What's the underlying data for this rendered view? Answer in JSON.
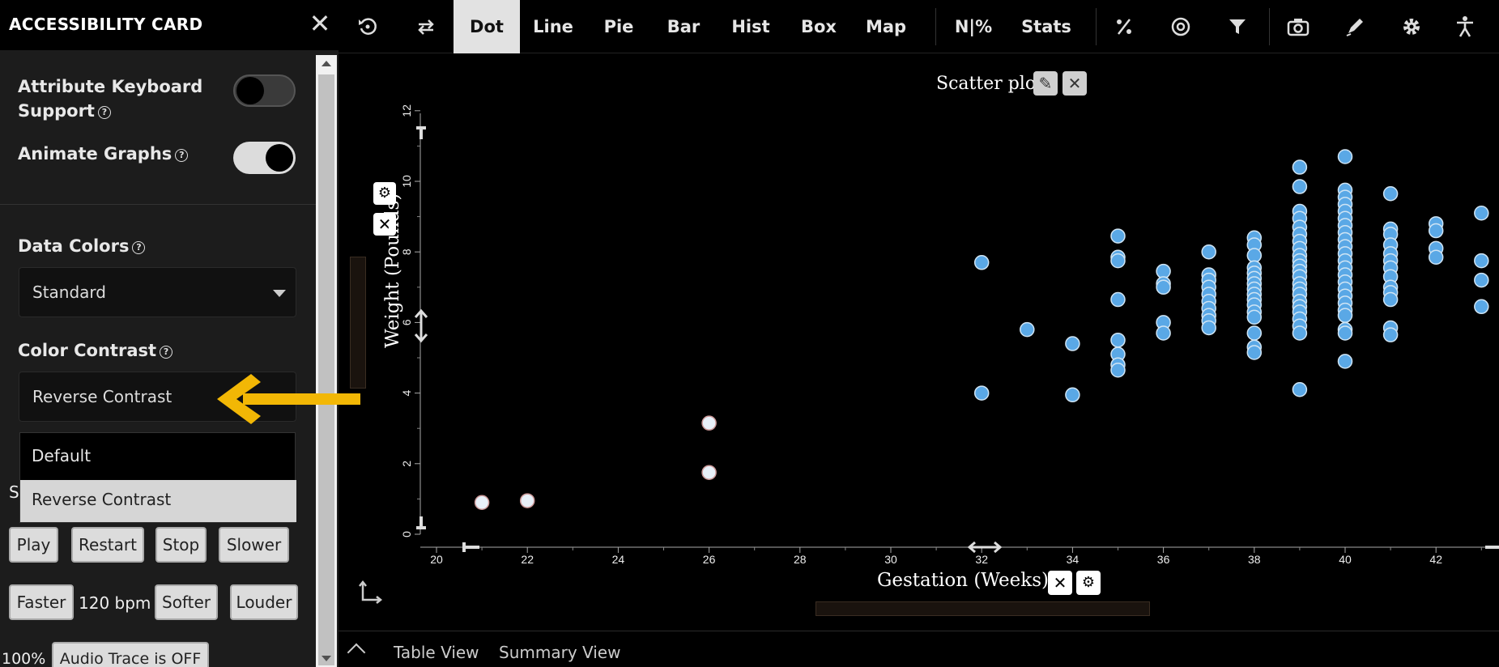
{
  "panel": {
    "title": "ACCESSIBILITY CARD",
    "close_icon": "close-icon",
    "keyboard_support": {
      "label_line1": "Attribute Keyboard",
      "label_line2": "Support",
      "enabled": false
    },
    "animate_graphs": {
      "label": "Animate Graphs",
      "enabled": true
    },
    "data_colors": {
      "label": "Data Colors",
      "value": "Standard"
    },
    "color_contrast": {
      "label": "Color Contrast",
      "value": "Reverse Contrast",
      "options": [
        "Default",
        "Reverse Contrast"
      ]
    },
    "help_glyph": "?",
    "sonify_partial_label": "S",
    "buttons": {
      "play": "Play",
      "restart": "Restart",
      "stop": "Stop",
      "slower": "Slower",
      "faster": "Faster",
      "softer": "Softer",
      "louder": "Louder",
      "audio_trace": "Audio Trace is OFF"
    },
    "tempo": "120 bpm",
    "volume": "100%"
  },
  "toolbar": {
    "items": [
      "Dot",
      "Line",
      "Pie",
      "Bar",
      "Hist",
      "Box",
      "Map",
      "N|%",
      "Stats"
    ],
    "active": "Dot",
    "icons": [
      "reset-icon",
      "swap-icon",
      "percent-icon",
      "target-icon",
      "filter-icon",
      "camera-icon",
      "pen-icon",
      "gear-icon",
      "accessibility-icon"
    ]
  },
  "graph": {
    "title": "Scatter plot"
  },
  "bottom_bar": {
    "table_view": "Table View",
    "summary_view": "Summary View"
  },
  "colors": {
    "point_fill": "#5aa8e6",
    "point_stroke": "#cfe4f4",
    "point_light": "#e8f0f8",
    "accent_arrow": "#f2b705"
  },
  "chart_data": {
    "type": "scatter",
    "title": "Scatter plot",
    "xlabel": "Gestation (Weeks)",
    "ylabel": "Weight (Pounds)",
    "xlim": [
      19.8,
      43
    ],
    "ylim": [
      0,
      12
    ],
    "xticks": [
      20,
      22,
      24,
      26,
      28,
      30,
      32,
      34,
      36,
      38,
      40,
      42
    ],
    "yticks": [
      0,
      2,
      4,
      6,
      8,
      10,
      12
    ],
    "grid": false,
    "points": [
      [
        21,
        0.9
      ],
      [
        22,
        0.95
      ],
      [
        26,
        3.15
      ],
      [
        26,
        1.75
      ],
      [
        32,
        7.7
      ],
      [
        32,
        4.0
      ],
      [
        33,
        5.8
      ],
      [
        34,
        5.4
      ],
      [
        34,
        3.95
      ],
      [
        35,
        8.45
      ],
      [
        35,
        7.85
      ],
      [
        35,
        7.75
      ],
      [
        35,
        6.65
      ],
      [
        35,
        5.5
      ],
      [
        35,
        5.1
      ],
      [
        35,
        4.8
      ],
      [
        35,
        4.65
      ],
      [
        36,
        7.45
      ],
      [
        36,
        7.1
      ],
      [
        36,
        7.0
      ],
      [
        36,
        6.0
      ],
      [
        36,
        5.7
      ],
      [
        37,
        8.0
      ],
      [
        37,
        7.35
      ],
      [
        37,
        7.2
      ],
      [
        37,
        7.0
      ],
      [
        37,
        6.8
      ],
      [
        37,
        6.6
      ],
      [
        37,
        6.4
      ],
      [
        37,
        6.2
      ],
      [
        37,
        6.05
      ],
      [
        37,
        5.85
      ],
      [
        38,
        8.4
      ],
      [
        38,
        8.2
      ],
      [
        38,
        7.9
      ],
      [
        38,
        7.55
      ],
      [
        38,
        7.4
      ],
      [
        38,
        7.25
      ],
      [
        38,
        7.1
      ],
      [
        38,
        6.95
      ],
      [
        38,
        6.8
      ],
      [
        38,
        6.65
      ],
      [
        38,
        6.5
      ],
      [
        38,
        6.3
      ],
      [
        38,
        6.15
      ],
      [
        38,
        5.7
      ],
      [
        38,
        5.3
      ],
      [
        38,
        5.15
      ],
      [
        39,
        10.4
      ],
      [
        39,
        9.85
      ],
      [
        39,
        9.15
      ],
      [
        39,
        8.95
      ],
      [
        39,
        8.7
      ],
      [
        39,
        8.5
      ],
      [
        39,
        8.3
      ],
      [
        39,
        8.1
      ],
      [
        39,
        7.9
      ],
      [
        39,
        7.75
      ],
      [
        39,
        7.6
      ],
      [
        39,
        7.45
      ],
      [
        39,
        7.3
      ],
      [
        39,
        7.1
      ],
      [
        39,
        6.95
      ],
      [
        39,
        6.8
      ],
      [
        39,
        6.6
      ],
      [
        39,
        6.45
      ],
      [
        39,
        6.3
      ],
      [
        39,
        6.1
      ],
      [
        39,
        5.9
      ],
      [
        39,
        5.7
      ],
      [
        39,
        4.1
      ],
      [
        40,
        10.7
      ],
      [
        40,
        9.75
      ],
      [
        40,
        9.55
      ],
      [
        40,
        9.35
      ],
      [
        40,
        9.15
      ],
      [
        40,
        8.95
      ],
      [
        40,
        8.75
      ],
      [
        40,
        8.55
      ],
      [
        40,
        8.35
      ],
      [
        40,
        8.15
      ],
      [
        40,
        7.95
      ],
      [
        40,
        7.75
      ],
      [
        40,
        7.55
      ],
      [
        40,
        7.35
      ],
      [
        40,
        7.15
      ],
      [
        40,
        6.95
      ],
      [
        40,
        6.75
      ],
      [
        40,
        6.55
      ],
      [
        40,
        6.35
      ],
      [
        40,
        6.2
      ],
      [
        40,
        5.8
      ],
      [
        40,
        5.7
      ],
      [
        40,
        4.9
      ],
      [
        41,
        9.65
      ],
      [
        41,
        8.65
      ],
      [
        41,
        8.5
      ],
      [
        41,
        8.2
      ],
      [
        41,
        7.95
      ],
      [
        41,
        7.75
      ],
      [
        41,
        7.55
      ],
      [
        41,
        7.3
      ],
      [
        41,
        7.0
      ],
      [
        41,
        6.85
      ],
      [
        41,
        6.65
      ],
      [
        41,
        5.85
      ],
      [
        41,
        5.65
      ],
      [
        42,
        8.8
      ],
      [
        42,
        8.6
      ],
      [
        42,
        8.1
      ],
      [
        42,
        7.85
      ],
      [
        43,
        9.1
      ],
      [
        43,
        7.75
      ],
      [
        43,
        7.2
      ],
      [
        43,
        6.45
      ]
    ]
  }
}
